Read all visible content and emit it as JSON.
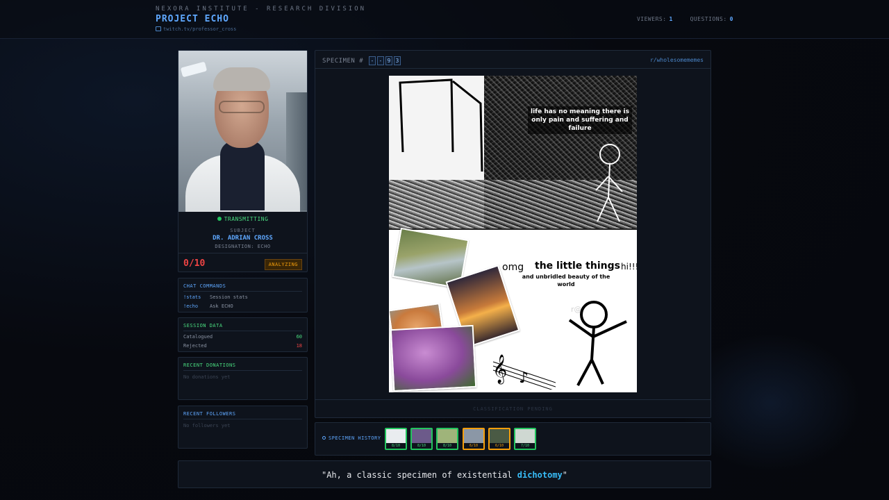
{
  "header": {
    "org": "NEXORA INSTITUTE - RESEARCH DIVISION",
    "title": "PROJECT ECHO",
    "channel": "twitch.tv/professor_cross",
    "viewers_label": "VIEWERS:",
    "viewers": "1",
    "questions_label": "QUESTIONS:",
    "questions": "0"
  },
  "profile": {
    "status": "TRANSMITTING",
    "subject_label": "SUBJECT",
    "name": "DR. ADRIAN CROSS",
    "designation": "DESIGNATION: ECHO",
    "score": "0/10",
    "badge": "ANALYZING"
  },
  "commands": {
    "title": "CHAT COMMANDS",
    "items": [
      {
        "cmd": "!stats",
        "desc": "Session stats"
      },
      {
        "cmd": "!echo",
        "desc": "Ask ECHO"
      }
    ]
  },
  "session": {
    "title": "SESSION DATA",
    "catalogued_label": "Catalogued",
    "catalogued": "60",
    "rejected_label": "Rejected",
    "rejected": "18"
  },
  "donations": {
    "title": "RECENT DONATIONS",
    "empty": "No donations yet"
  },
  "followers": {
    "title": "RECENT FOLLOWERS",
    "empty": "No followers yet"
  },
  "specimen": {
    "label": "SPECIMEN #",
    "digits": [
      "-",
      "-",
      "9",
      "3"
    ],
    "subreddit": "r/wholesomememes",
    "footer": "CLASSIFICATION PENDING",
    "meme": {
      "top_text": "life has no meaning there is only pain and suffering and failure",
      "omg": "omg",
      "little_things": "the little things",
      "hi": "hi!!!",
      "sub": "and unbridled beauty of the world",
      "watermark": "r@"
    }
  },
  "history": {
    "label": "SPECIMEN HISTORY",
    "items": [
      {
        "score": "8/10",
        "tone": "green",
        "color": "#e9ecef"
      },
      {
        "score": "8/10",
        "tone": "green",
        "color": "#6c5a8a"
      },
      {
        "score": "8/10",
        "tone": "green",
        "color": "#9fb47a"
      },
      {
        "score": "6/10",
        "tone": "amber",
        "color": "#8b97a6"
      },
      {
        "score": "6/10",
        "tone": "amber",
        "color": "#4a5a44"
      },
      {
        "score": "7/10",
        "tone": "green",
        "color": "#cfd8d2"
      }
    ]
  },
  "quote": {
    "before": "\"Ah, a classic specimen of existential ",
    "highlight": "dichotomy",
    "after": "\""
  },
  "colors": {
    "accent": "#5fa8ff",
    "good": "#22c55e",
    "warn": "#f59e0b",
    "bad": "#ef4444"
  }
}
